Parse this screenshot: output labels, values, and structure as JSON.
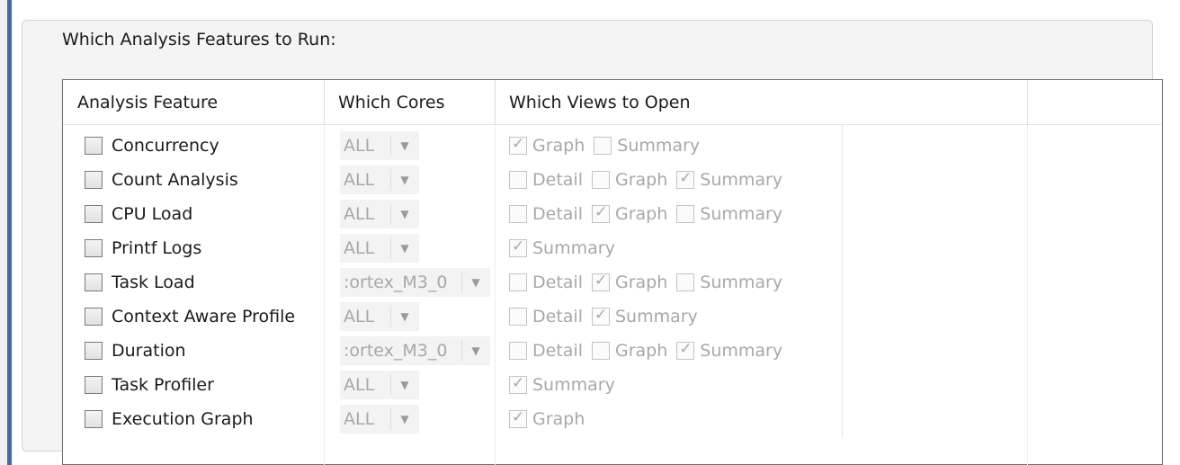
{
  "group_title": "Which Analysis Features to Run:",
  "columns": [
    "Analysis Feature",
    "Which Cores",
    "Which Views to Open"
  ],
  "rows": [
    {
      "feature": "Concurrency",
      "checked": false,
      "cores": "ALL",
      "views": [
        {
          "label": "Graph",
          "checked": true
        },
        {
          "label": "Summary",
          "checked": false
        }
      ]
    },
    {
      "feature": "Count Analysis",
      "checked": false,
      "cores": "ALL",
      "views": [
        {
          "label": "Detail",
          "checked": false
        },
        {
          "label": "Graph",
          "checked": false
        },
        {
          "label": "Summary",
          "checked": true
        }
      ]
    },
    {
      "feature": "CPU Load",
      "checked": false,
      "cores": "ALL",
      "views": [
        {
          "label": "Detail",
          "checked": false
        },
        {
          "label": "Graph",
          "checked": true
        },
        {
          "label": "Summary",
          "checked": false
        }
      ]
    },
    {
      "feature": "Printf Logs",
      "checked": false,
      "cores": "ALL",
      "views": [
        {
          "label": "Summary",
          "checked": true
        }
      ]
    },
    {
      "feature": "Task Load",
      "checked": false,
      "cores": ":ortex_M3_0",
      "views": [
        {
          "label": "Detail",
          "checked": false
        },
        {
          "label": "Graph",
          "checked": true
        },
        {
          "label": "Summary",
          "checked": false
        }
      ]
    },
    {
      "feature": "Context Aware Profile",
      "checked": false,
      "cores": "ALL",
      "views": [
        {
          "label": "Detail",
          "checked": false
        },
        {
          "label": "Summary",
          "checked": true
        }
      ]
    },
    {
      "feature": "Duration",
      "checked": false,
      "cores": ":ortex_M3_0",
      "views": [
        {
          "label": "Detail",
          "checked": false
        },
        {
          "label": "Graph",
          "checked": false
        },
        {
          "label": "Summary",
          "checked": true
        }
      ]
    },
    {
      "feature": "Task Profiler",
      "checked": false,
      "cores": "ALL",
      "views": [
        {
          "label": "Summary",
          "checked": true
        }
      ]
    },
    {
      "feature": "Execution Graph",
      "checked": false,
      "cores": "ALL",
      "views": [
        {
          "label": "Graph",
          "checked": true
        }
      ]
    }
  ],
  "icons": {
    "combo_arrow": "chevron-down-icon",
    "view_check": "checkmark-icon"
  },
  "colors": {
    "window_accent": "#4b6aa0",
    "disabled_text": "#a8a8a8",
    "table_border": "#6f6f6f"
  }
}
